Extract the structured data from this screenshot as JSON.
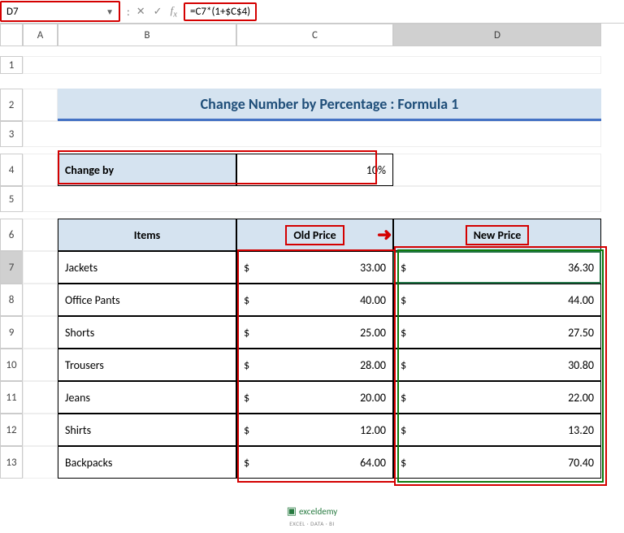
{
  "formula_bar": {
    "cell_ref": "D7",
    "formula": "=C7*(1+$C$4)"
  },
  "columns": [
    "A",
    "B",
    "C",
    "D"
  ],
  "rows": [
    "1",
    "2",
    "3",
    "4",
    "5",
    "6",
    "7",
    "8",
    "9",
    "10",
    "11",
    "12",
    "13"
  ],
  "title": "Change Number by Percentage : Formula 1",
  "change_by": {
    "label": "Change by",
    "value": "10%"
  },
  "headers": {
    "items": "Items",
    "old": "Old Price",
    "new": "New Price"
  },
  "data": [
    {
      "item": "Jackets",
      "old": "33.00",
      "new": "36.30"
    },
    {
      "item": "Office Pants",
      "old": "40.00",
      "new": "44.00"
    },
    {
      "item": "Shorts",
      "old": "25.00",
      "new": "27.50"
    },
    {
      "item": "Trousers",
      "old": "28.00",
      "new": "30.80"
    },
    {
      "item": "Jeans",
      "old": "20.00",
      "new": "22.00"
    },
    {
      "item": "Shirts",
      "old": "12.00",
      "new": "13.20"
    },
    {
      "item": "Backpacks",
      "old": "64.00",
      "new": "70.40"
    }
  ],
  "footer": {
    "brand": "exceldemy",
    "tag": "EXCEL · DATA · BI"
  },
  "chart_data": {
    "type": "table",
    "title": "Change Number by Percentage : Formula 1",
    "change_percent": 10,
    "columns": [
      "Items",
      "Old Price",
      "New Price"
    ],
    "rows": [
      [
        "Jackets",
        33.0,
        36.3
      ],
      [
        "Office Pants",
        40.0,
        44.0
      ],
      [
        "Shorts",
        25.0,
        27.5
      ],
      [
        "Trousers",
        28.0,
        30.8
      ],
      [
        "Jeans",
        20.0,
        22.0
      ],
      [
        "Shirts",
        12.0,
        13.2
      ],
      [
        "Backpacks",
        64.0,
        70.4
      ]
    ]
  }
}
